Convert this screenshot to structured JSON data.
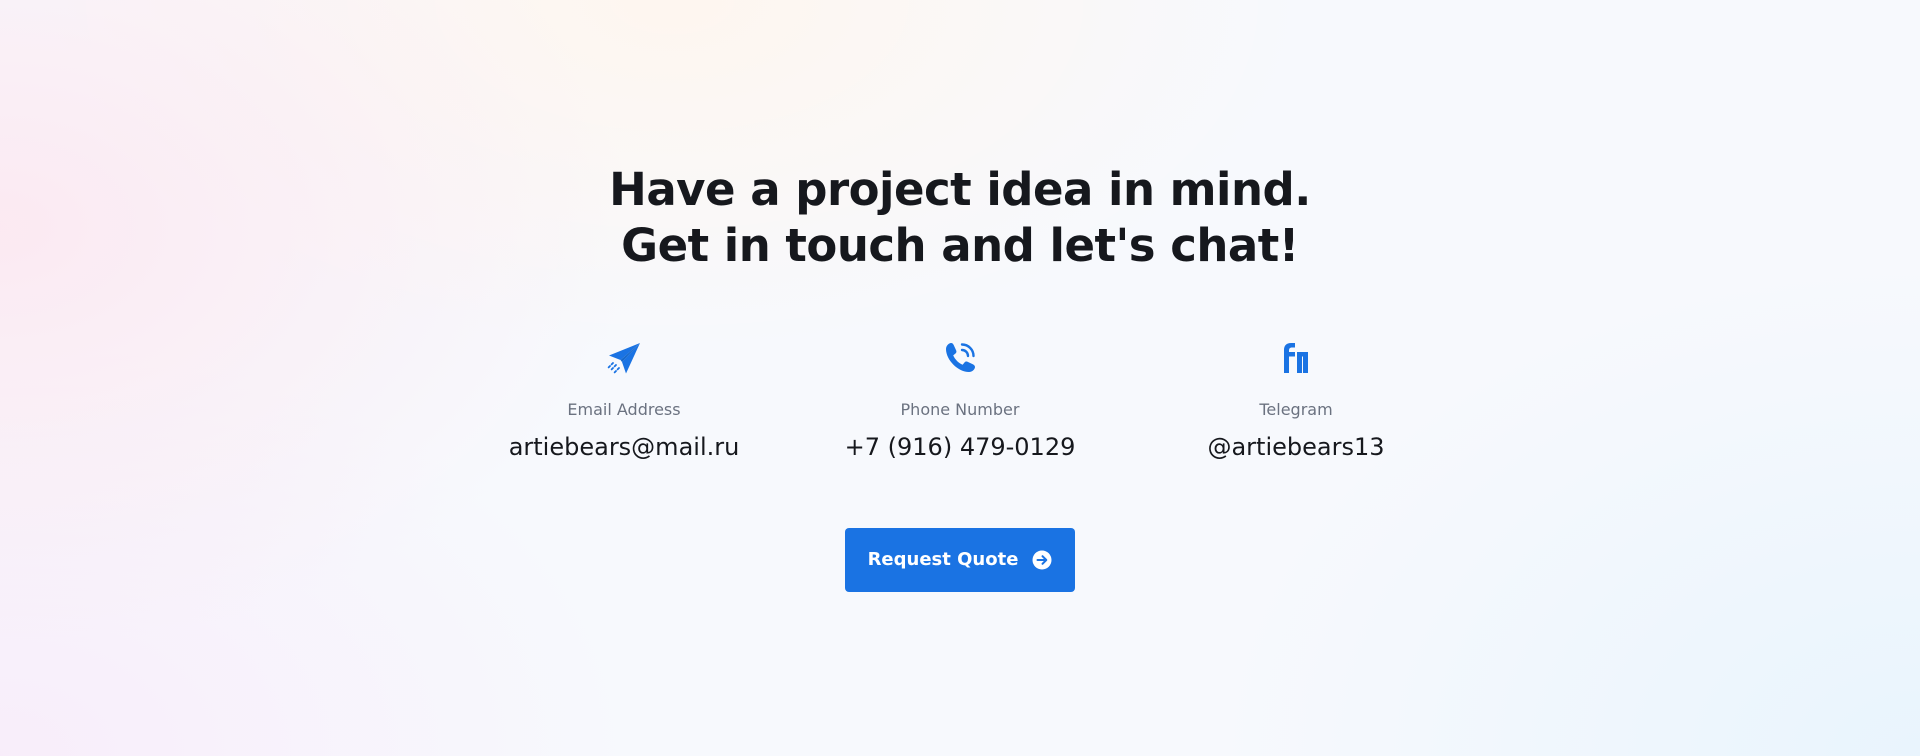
{
  "headline": {
    "line1": "Have a project idea in mind.",
    "line2": "Get in touch and let's chat!"
  },
  "contacts": [
    {
      "icon": "paper-plane-icon",
      "label": "Email Address",
      "value": "artiebears@mail.ru"
    },
    {
      "icon": "phone-ringing-icon",
      "label": "Phone Number",
      "value": "+7 (916) 479-0129"
    },
    {
      "icon": "fi-logo-icon",
      "label": "Telegram",
      "value": "@artiebears13"
    }
  ],
  "cta": {
    "label": "Request Quote",
    "icon": "arrow-right-circle-icon"
  },
  "colors": {
    "accent": "#1a73e3",
    "heading": "#16181d",
    "muted": "#6b7280",
    "button_text": "#ffffff"
  }
}
